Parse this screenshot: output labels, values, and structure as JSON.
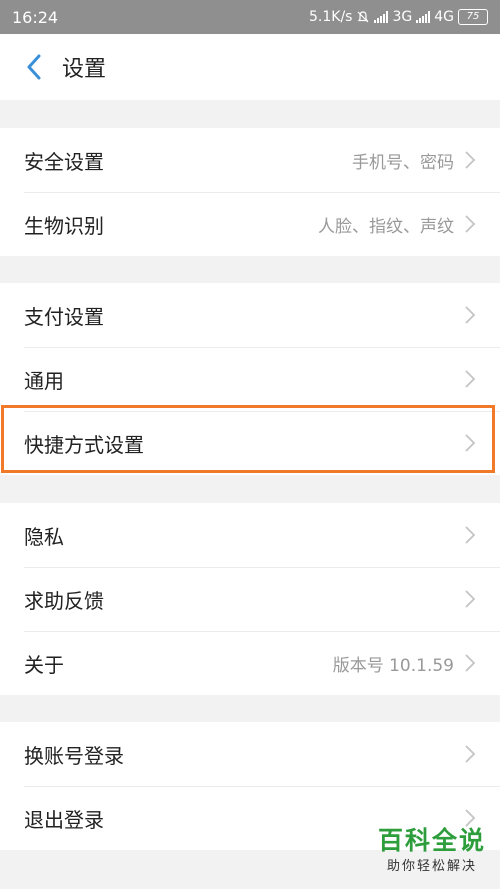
{
  "status_bar": {
    "time": "16:24",
    "speed": "5.1K/s",
    "net1": "3G",
    "net2": "4G",
    "battery": "75"
  },
  "header": {
    "title": "设置"
  },
  "groups": [
    {
      "items": [
        {
          "label": "安全设置",
          "value": "手机号、密码"
        },
        {
          "label": "生物识别",
          "value": "人脸、指纹、声纹"
        }
      ]
    },
    {
      "items": [
        {
          "label": "支付设置"
        },
        {
          "label": "通用"
        },
        {
          "label": "快捷方式设置"
        }
      ]
    },
    {
      "items": [
        {
          "label": "隐私"
        },
        {
          "label": "求助反馈"
        },
        {
          "label": "关于",
          "value": "版本号 10.1.59"
        }
      ]
    },
    {
      "items": [
        {
          "label": "换账号登录"
        },
        {
          "label": "退出登录"
        }
      ]
    }
  ],
  "watermark": {
    "main": "百科全说",
    "sub": "助你轻松解决"
  },
  "colors": {
    "accent": "#3a8fd8",
    "highlight": "#f07a2a",
    "watermark": "#2e9e3d"
  }
}
